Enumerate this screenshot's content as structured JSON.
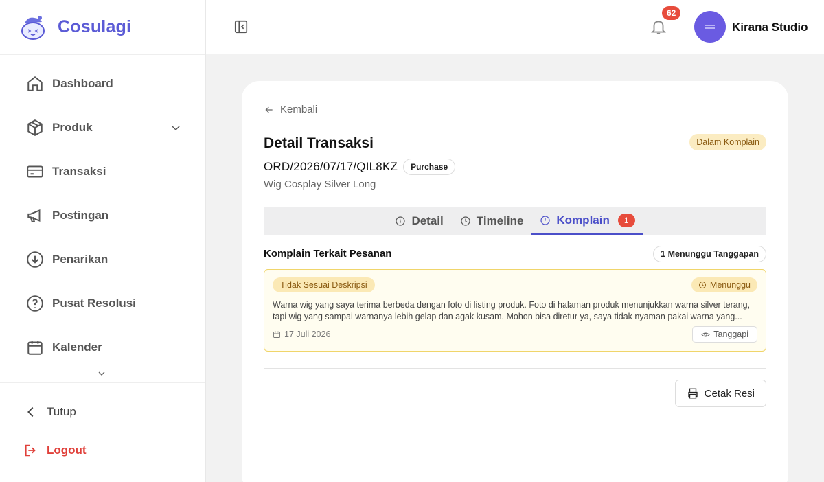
{
  "brand": {
    "name": "Cosulagi"
  },
  "sidebar": {
    "items": [
      {
        "label": "Dashboard",
        "icon": "home-icon"
      },
      {
        "label": "Produk",
        "icon": "box-icon"
      },
      {
        "label": "Transaksi",
        "icon": "credit-card-icon"
      },
      {
        "label": "Postingan",
        "icon": "megaphone-icon"
      },
      {
        "label": "Penarikan",
        "icon": "download-circle-icon"
      },
      {
        "label": "Pusat Resolusi",
        "icon": "help-circle-icon"
      },
      {
        "label": "Kalender",
        "icon": "calendar-icon"
      }
    ],
    "collapse_label": "Tutup",
    "logout_label": "Logout"
  },
  "header": {
    "notification_count": "62",
    "user_name": "Kirana Studio"
  },
  "detail": {
    "back_label": "Kembali",
    "title": "Detail Transaksi",
    "status": "Dalam Komplain",
    "order_no": "ORD/2026/07/17/QIL8KZ",
    "order_type": "Purchase",
    "product_name": "Wig Cosplay Silver Long",
    "tabs": [
      {
        "label": "Detail"
      },
      {
        "label": "Timeline"
      },
      {
        "label": "Komplain",
        "badge": "1"
      }
    ],
    "section_title": "Komplain Terkait Pesanan",
    "waiting_summary": "1 Menunggu Tanggapan",
    "complaint": {
      "category": "Tidak Sesuai Deskripsi",
      "status": "Menunggu",
      "text": "Warna wig yang saya terima berbeda dengan foto di listing produk. Foto di halaman produk menunjukkan warna silver terang, tapi wig yang sampai warnanya lebih gelap dan agak kusam. Mohon bisa diretur ya, saya tidak nyaman pakai warna yang...",
      "date": "17 Juli 2026",
      "reply_label": "Tanggapi"
    },
    "print_label": "Cetak Resi"
  },
  "colors": {
    "accent": "#4b4fc9",
    "brand": "#5b5bd6",
    "danger": "#e74c3c",
    "warning_bg": "#fbe9b5"
  }
}
